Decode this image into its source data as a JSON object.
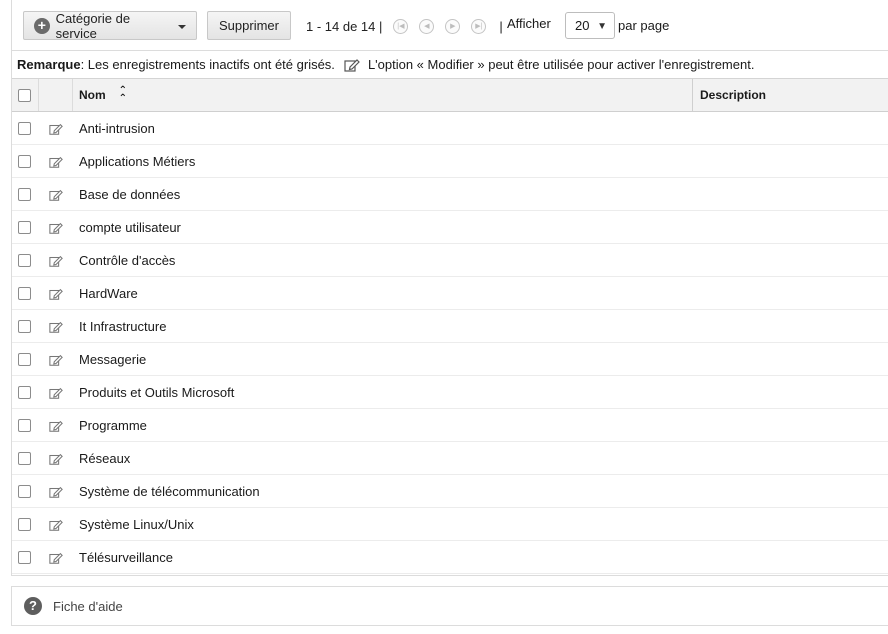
{
  "toolbar": {
    "category_button_label": "Catégorie de service",
    "delete_button_label": "Supprimer",
    "pager_text": "1 - 14 de 14 |",
    "pager_end_sep": "|",
    "show_label": "Afficher",
    "per_page_value": "20",
    "per_page_suffix": "par page"
  },
  "note": {
    "bold_label": "Remarque",
    "text": " : Les enregistrements inactifs ont été grisés.",
    "edit_hint": "L'option « Modifier » peut être utilisée pour activer l'enregistrement."
  },
  "grid": {
    "columns": {
      "name": "Nom",
      "description": "Description"
    },
    "rows": [
      {
        "name": "Anti-intrusion"
      },
      {
        "name": "Applications Métiers"
      },
      {
        "name": "Base de données"
      },
      {
        "name": "compte utilisateur"
      },
      {
        "name": "Contrôle d'accès"
      },
      {
        "name": "HardWare"
      },
      {
        "name": "It Infrastructure"
      },
      {
        "name": "Messagerie"
      },
      {
        "name": "Produits et Outils Microsoft"
      },
      {
        "name": "Programme"
      },
      {
        "name": "Réseaux"
      },
      {
        "name": "Système de télécommunication"
      },
      {
        "name": "Système Linux/Unix"
      },
      {
        "name": "Télésurveillance"
      }
    ]
  },
  "help": {
    "label": "Fiche d'aide"
  }
}
